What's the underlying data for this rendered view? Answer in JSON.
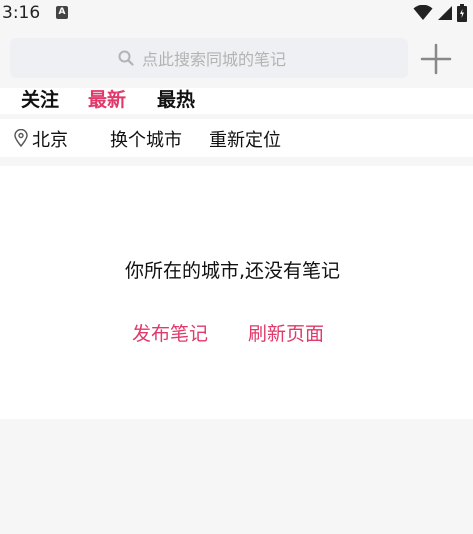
{
  "status_bar": {
    "time": "3:16",
    "notif_icon": "A"
  },
  "search": {
    "placeholder": "点此搜索同城的笔记"
  },
  "tabs": [
    {
      "label": "关注",
      "active": false
    },
    {
      "label": "最新",
      "active": true
    },
    {
      "label": "最热",
      "active": false
    }
  ],
  "location": {
    "city": "北京",
    "change_city": "换个城市",
    "relocate": "重新定位"
  },
  "empty_state": {
    "message": "你所在的城市,还没有笔记",
    "publish": "发布笔记",
    "refresh": "刷新页面"
  },
  "colors": {
    "accent": "#e0396a",
    "search_bg": "#eef0f3"
  },
  "icons": [
    "wifi-icon",
    "signal-icon",
    "battery-icon",
    "search-icon",
    "plus-icon",
    "location-pin-icon"
  ]
}
